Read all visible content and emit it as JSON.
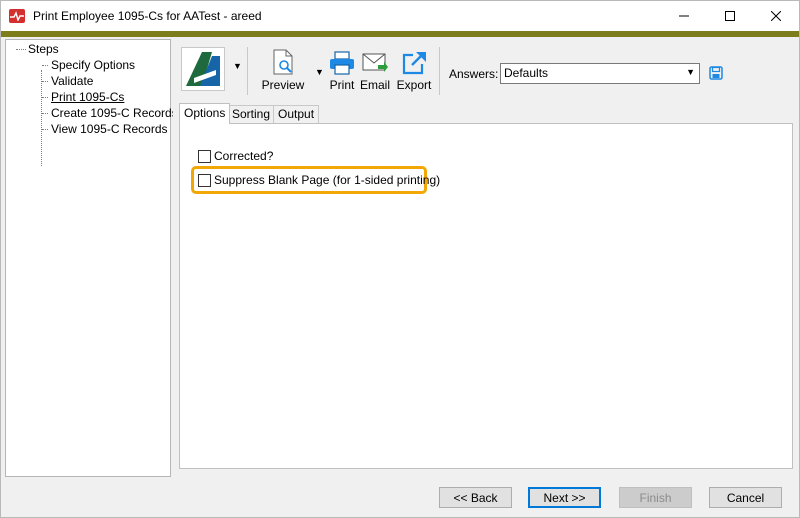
{
  "window": {
    "title": "Print Employee 1095-Cs for AATest - areed",
    "accent_color": "#7d7d1c"
  },
  "steps": {
    "root": "Steps",
    "items": [
      {
        "label": "Specify Options",
        "current": false
      },
      {
        "label": "Validate",
        "current": false
      },
      {
        "label": "Print 1095-Cs",
        "current": true
      },
      {
        "label": "Create 1095-C Records",
        "current": false
      },
      {
        "label": "View 1095-C Records",
        "current": false
      }
    ]
  },
  "toolbar": {
    "preview_label": "Preview",
    "print_label": "Print",
    "email_label": "Email",
    "export_label": "Export",
    "answers_label": "Answers:",
    "answers_value": "Defaults",
    "icons": [
      "app-logo-icon",
      "preview-icon",
      "print-icon",
      "email-icon",
      "export-icon",
      "save-icon"
    ]
  },
  "tabs": [
    {
      "label": "Options",
      "active": true
    },
    {
      "label": "Sorting",
      "active": false
    },
    {
      "label": "Output",
      "active": false
    }
  ],
  "options": {
    "corrected_label": "Corrected?",
    "corrected_checked": false,
    "suppress_label": "Suppress Blank Page (for 1-sided printing)",
    "suppress_checked": false,
    "highlight_color": "#f2a705"
  },
  "buttons": {
    "back": "<< Back",
    "next": "Next >>",
    "finish": "Finish",
    "cancel": "Cancel"
  }
}
